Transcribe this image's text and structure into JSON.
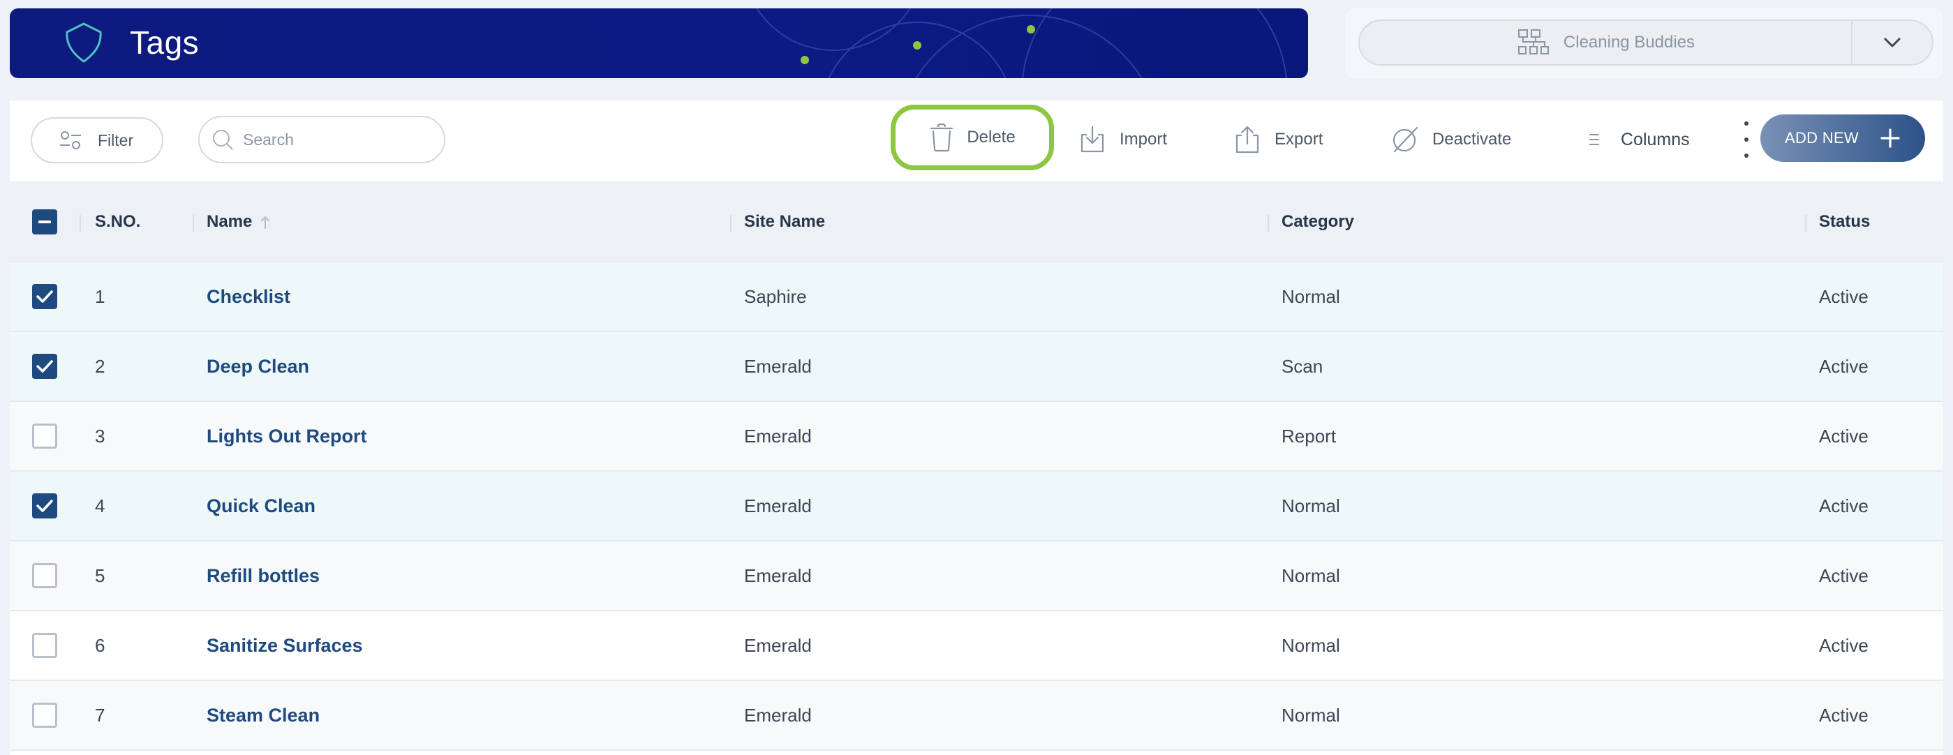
{
  "header": {
    "title": "Tags"
  },
  "site_selector": {
    "value": "Cleaning Buddies"
  },
  "toolbar": {
    "filter_label": "Filter",
    "search_placeholder": "Search",
    "delete_label": "Delete",
    "import_label": "Import",
    "export_label": "Export",
    "deactivate_label": "Deactivate",
    "columns_label": "Columns",
    "add_new_label": "ADD NEW"
  },
  "table": {
    "columns": [
      "S.NO.",
      "Name",
      "Site Name",
      "Category",
      "Status"
    ],
    "rows": [
      {
        "selected": true,
        "sno": "1",
        "name": "Checklist",
        "site": "Saphire",
        "category": "Normal",
        "status": "Active"
      },
      {
        "selected": true,
        "sno": "2",
        "name": "Deep Clean",
        "site": "Emerald",
        "category": "Scan",
        "status": "Active"
      },
      {
        "selected": false,
        "sno": "3",
        "name": "Lights Out Report",
        "site": "Emerald",
        "category": "Report",
        "status": "Active"
      },
      {
        "selected": true,
        "sno": "4",
        "name": "Quick Clean",
        "site": "Emerald",
        "category": "Normal",
        "status": "Active"
      },
      {
        "selected": false,
        "sno": "5",
        "name": "Refill bottles",
        "site": "Emerald",
        "category": "Normal",
        "status": "Active"
      },
      {
        "selected": false,
        "sno": "6",
        "name": "Sanitize Surfaces",
        "site": "Emerald",
        "category": "Normal",
        "status": "Active"
      },
      {
        "selected": false,
        "sno": "7",
        "name": "Steam Clean",
        "site": "Emerald",
        "category": "Normal",
        "status": "Active"
      }
    ]
  },
  "colors": {
    "banner": "#0c1a86",
    "accent": "#1f4a80",
    "delete_highlight": "#8dc63f",
    "selected_row": "#eef8f8"
  },
  "icons": [
    "shield-logo-icon",
    "sitemap-icon",
    "chevron-down-icon",
    "filter-icon",
    "search-icon",
    "trash-icon",
    "import-icon",
    "export-icon",
    "deactivate-icon",
    "columns-icon",
    "kebab-menu-icon",
    "plus-icon",
    "checkbox-icon",
    "sort-ascending-icon"
  ]
}
